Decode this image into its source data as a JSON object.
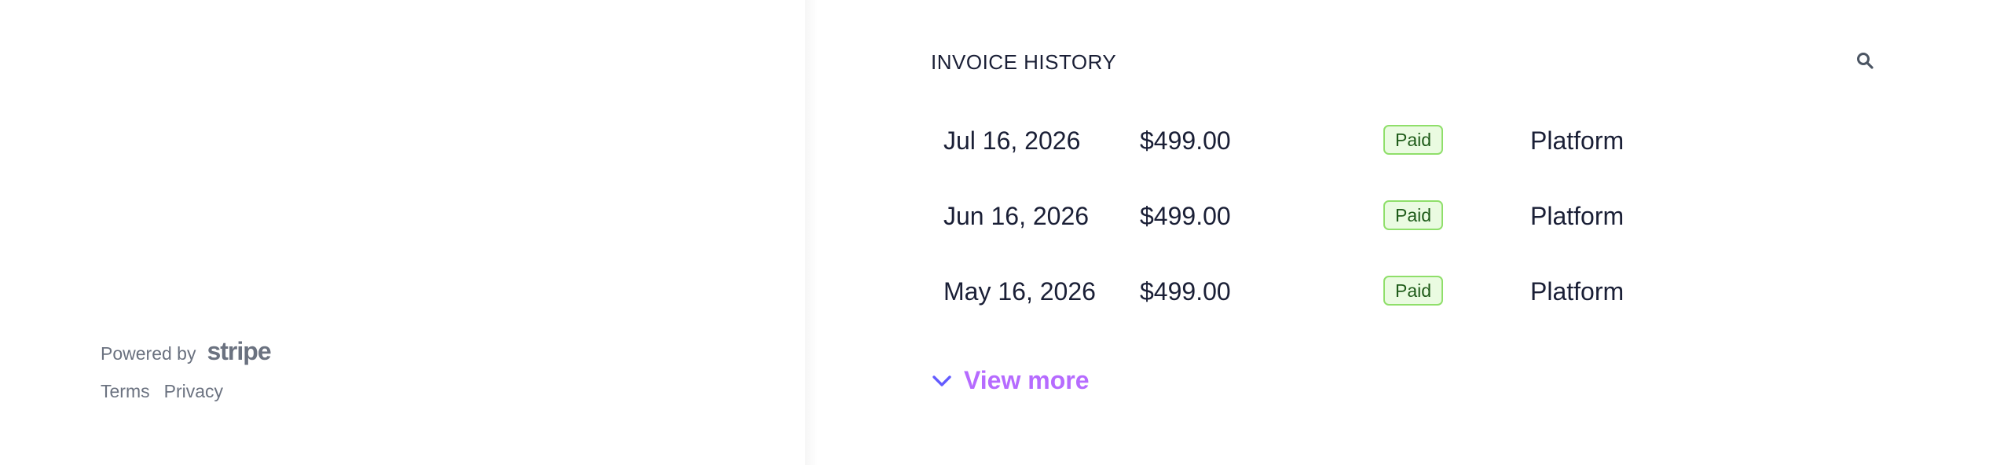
{
  "footer": {
    "powered_by_label": "Powered by",
    "brand_logo_text": "stripe",
    "links": [
      "Terms",
      "Privacy"
    ]
  },
  "invoice_history": {
    "title": "INVOICE HISTORY",
    "search_icon": "search-icon",
    "rows": [
      {
        "date": "Jul 16, 2026",
        "amount": "$499.00",
        "status": "Paid",
        "product": "Platform"
      },
      {
        "date": "Jun 16, 2026",
        "amount": "$499.00",
        "status": "Paid",
        "product": "Platform"
      },
      {
        "date": "May 16, 2026",
        "amount": "$499.00",
        "status": "Paid",
        "product": "Platform"
      }
    ],
    "view_more_label": "View more",
    "view_more_icon": "chevron-down-icon"
  },
  "colors": {
    "text_primary": "#1a1f36",
    "text_muted": "#6b7280",
    "accent_purple": "#b66bff",
    "chevron_blue": "#635bff",
    "badge_bg": "#eafbe1",
    "badge_border": "#8fdf6a",
    "badge_text": "#1f5c1a"
  }
}
